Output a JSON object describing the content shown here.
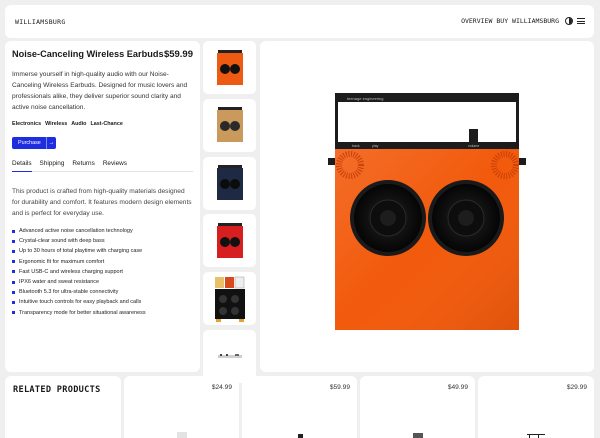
{
  "nav": {
    "brand": "WILLIAMSBURG",
    "links": [
      "OVERVIEW",
      "BUY WILLIAMSBURG"
    ]
  },
  "product": {
    "title": "Noise-Canceling Wireless Earbuds",
    "price": "$59.99",
    "description": "Immerse yourself in high-quality audio with our Noise-Canceling Wireless Earbuds. Designed for music lovers and professionals alike, they deliver superior sound clarity and active noise cancellation.",
    "tags": [
      "Electronics",
      "Wireless",
      "Audio",
      "Last-Chance"
    ],
    "purchase_label": "Purchase",
    "purchase_arrow": "→",
    "tabs": [
      "Details",
      "Shipping",
      "Returns",
      "Reviews"
    ],
    "details_text": "This product is crafted from high-quality materials designed for durability and comfort. It features modern design elements and is perfect for everyday use.",
    "features": [
      "Advanced active noise cancellation technology",
      "Crystal-clear sound with deep bass",
      "Up to 30 hours of total playtime with charging case",
      "Ergonomic fit for maximum comfort",
      "Fast USB-C and wireless charging support",
      "IPX6 water and sweat resistance",
      "Bluetooth 5.3 for ultra-stable connectivity",
      "Intuitive touch controls for easy playback and calls",
      "Transparency mode for better situational awareness"
    ]
  },
  "hero_image": {
    "brand_text": "teenage engineering",
    "knob_labels": [
      "track",
      "play",
      "volume"
    ],
    "colors": {
      "body": "#f25a0c",
      "frame": "#1c1c1c"
    }
  },
  "thumbnails": [
    {
      "name": "orange",
      "color": "#ef5a12"
    },
    {
      "name": "tan",
      "color": "#c99a5c"
    },
    {
      "name": "navy",
      "color": "#1e2a44"
    },
    {
      "name": "red",
      "color": "#d81f1f"
    },
    {
      "name": "stacked",
      "color": "#111111"
    },
    {
      "name": "slim",
      "color": "#888888"
    }
  ],
  "related": {
    "title": "RELATED PRODUCTS",
    "items": [
      {
        "price": "$24.99"
      },
      {
        "price": "$59.99"
      },
      {
        "price": "$49.99"
      },
      {
        "price": "$29.99"
      }
    ]
  },
  "colors": {
    "accent": "#1f2de0",
    "background": "#efefef"
  }
}
